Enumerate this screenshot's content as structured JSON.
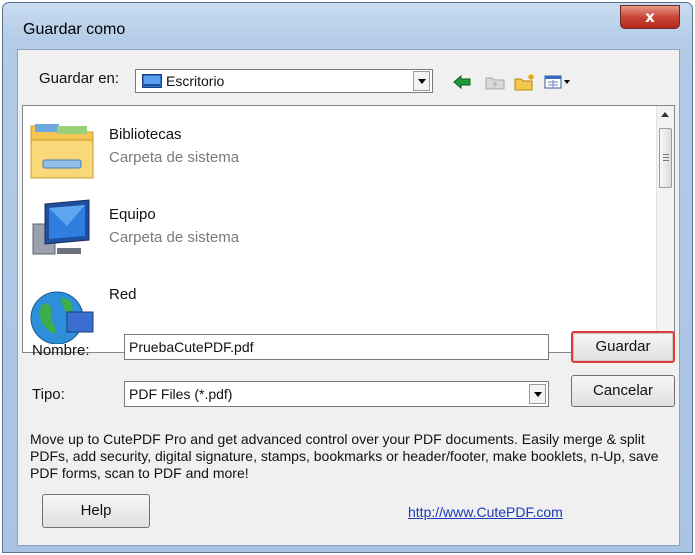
{
  "window": {
    "title": "Guardar como",
    "close_label": "x"
  },
  "toolbar": {
    "save_in_label": "Guardar en:",
    "location": "Escritorio",
    "icons": [
      "back-arrow-icon",
      "up-folder-icon",
      "new-folder-icon",
      "view-menu-icon"
    ]
  },
  "files": [
    {
      "name": "Bibliotecas",
      "type": "Carpeta de sistema",
      "icon": "libraries-folder-icon"
    },
    {
      "name": "Equipo",
      "type": "Carpeta de sistema",
      "icon": "computer-icon"
    },
    {
      "name": "Red",
      "type": "",
      "icon": "network-globe-icon"
    }
  ],
  "form": {
    "name_label": "Nombre:",
    "name_value": "PruebaCutePDF.pdf",
    "type_label": "Tipo:",
    "type_value": "PDF Files (*.pdf)",
    "save_button": "Guardar",
    "cancel_button": "Cancelar"
  },
  "promo": {
    "text": "Move up to CutePDF Pro and get advanced control over your PDF documents. Easily merge & split PDFs, add security, digital signature, stamps, bookmarks or header/footer, make booklets, n-Up, save PDF forms, scan to PDF and more!",
    "link": "http://www.CutePDF.com"
  },
  "help_button": "Help",
  "colors": {
    "accent_border": "#e03a3a",
    "close_red": "#c8473a",
    "link": "#1a3ab8"
  }
}
